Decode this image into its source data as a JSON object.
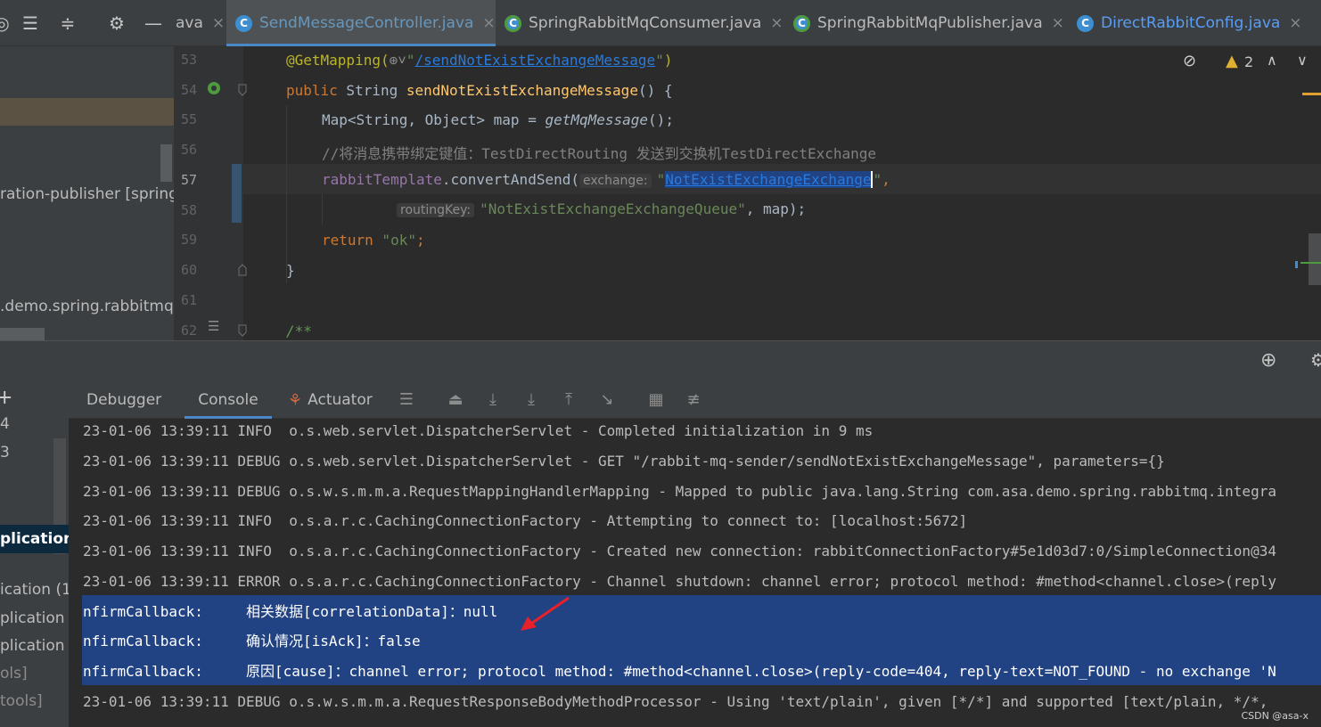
{
  "toolbar": {
    "icons": [
      "target-icon",
      "expand-all-icon",
      "collapse-all-icon",
      "gear-icon",
      "minimize-icon"
    ]
  },
  "tabs": [
    {
      "label": "ava",
      "close": "×"
    },
    {
      "label": "SendMessageController.java",
      "close": "×",
      "active": true
    },
    {
      "label": "SpringRabbitMqConsumer.java",
      "close": "×"
    },
    {
      "label": "SpringRabbitMqPublisher.java",
      "close": "×"
    },
    {
      "label": "DirectRabbitConfig.java",
      "close": "×"
    }
  ],
  "project": {
    "row1": "ration-publisher [spring",
    "row2": ".demo.spring.rabbitmq.i"
  },
  "editor": {
    "warnings_count": "2",
    "line_numbers": [
      "53",
      "54",
      "55",
      "56",
      "57",
      "58",
      "59",
      "60",
      "61",
      "62"
    ],
    "lines": {
      "l53_ann": "@GetMapping(",
      "l53_path": "/sendNotExistExchangeMessage",
      "l54_kw": "public",
      "l54_type": " String ",
      "l54_name": "sendNotExistExchangeMessage",
      "l54_rest": "() {",
      "l55_a": "Map<String, Object> map = ",
      "l55_call": "getMqMessage",
      "l55_rest": "();",
      "l56": "//将消息携带绑定键值：TestDirectRouting 发送到交换机TestDirectExchange",
      "l57_field": "rabbitTemplate",
      "l57_call": ".convertAndSend(",
      "l57_hint": "exchange:",
      "l57_str": "NotExistExchangeExchange",
      "l58_hint": "routingKey:",
      "l58_str": "\"NotExistExchangeExchangeQueue\"",
      "l58_rest": ", map);",
      "l59_kw": "return",
      "l59_str": " \"ok\"",
      "l59_rest": ";",
      "l60": "}",
      "l62": "/**"
    }
  },
  "debug": {
    "tabs": [
      "Debugger",
      "Console",
      "Actuator"
    ],
    "left_rows": [
      "4",
      "3",
      "plication",
      "ication (1",
      "plication [",
      "plication",
      "ols]",
      "tools]"
    ]
  },
  "console": {
    "lines": [
      "23-01-06 13:39:11 INFO  o.s.web.servlet.DispatcherServlet - Completed initialization in 9 ms",
      "23-01-06 13:39:11 DEBUG o.s.web.servlet.DispatcherServlet - GET \"/rabbit-mq-sender/sendNotExistExchangeMessage\", parameters={}",
      "23-01-06 13:39:11 DEBUG o.s.w.s.m.m.a.RequestMappingHandlerMapping - Mapped to public java.lang.String com.asa.demo.spring.rabbitmq.integra",
      "23-01-06 13:39:11 INFO  o.s.a.r.c.CachingConnectionFactory - Attempting to connect to: [localhost:5672]",
      "23-01-06 13:39:11 INFO  o.s.a.r.c.CachingConnectionFactory - Created new connection: rabbitConnectionFactory#5e1d03d7:0/SimpleConnection@34",
      "23-01-06 13:39:11 ERROR o.s.a.r.c.CachingConnectionFactory - Channel shutdown: channel error; protocol method: #method<channel.close>(reply",
      "nfirmCallback:     相关数据[correlationData]：null",
      "nfirmCallback:     确认情况[isAck]：false",
      "nfirmCallback:     原因[cause]：channel error; protocol method: #method<channel.close>(reply-code=404, reply-text=NOT_FOUND - no exchange 'N",
      "23-01-06 13:39:11 DEBUG o.s.w.s.m.m.a.RequestResponseBodyMethodProcessor - Using 'text/plain', given [*/*] and supported [text/plain, */*,"
    ]
  },
  "watermark": "CSDN @asa-x"
}
